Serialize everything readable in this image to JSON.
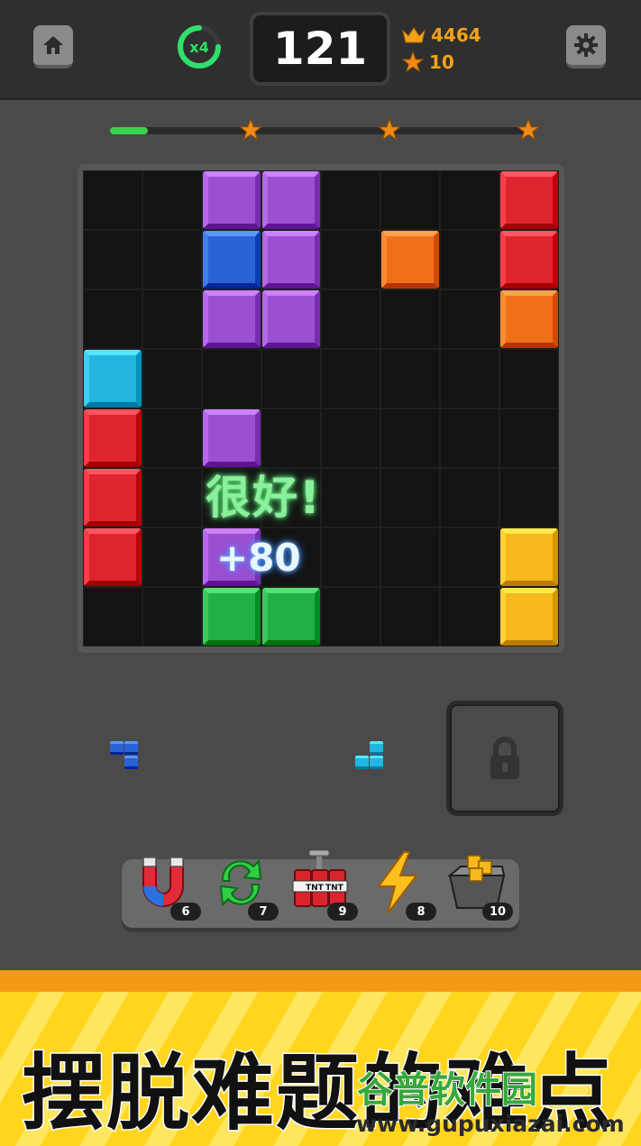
{
  "header": {
    "home_icon": "home-icon",
    "combo_multiplier": "x4",
    "score": "121",
    "best_score": "4464",
    "stars": "10",
    "settings_icon": "gear-icon"
  },
  "progress": {
    "fill_fraction": 0.09,
    "milestone_icon": "star-icon",
    "milestones": 3
  },
  "board": {
    "rows": 8,
    "cols": 8,
    "blocks": [
      {
        "row": 0,
        "col": 2,
        "color": "#9b4fd1"
      },
      {
        "row": 0,
        "col": 3,
        "color": "#9b4fd1"
      },
      {
        "row": 0,
        "col": 7,
        "color": "#e0242f"
      },
      {
        "row": 1,
        "col": 2,
        "color": "#2a63d6"
      },
      {
        "row": 1,
        "col": 3,
        "color": "#9b4fd1"
      },
      {
        "row": 1,
        "col": 5,
        "color": "#f0701a"
      },
      {
        "row": 1,
        "col": 7,
        "color": "#e0242f"
      },
      {
        "row": 2,
        "col": 2,
        "color": "#9b4fd1"
      },
      {
        "row": 2,
        "col": 3,
        "color": "#9b4fd1"
      },
      {
        "row": 2,
        "col": 7,
        "color": "#f0701a"
      },
      {
        "row": 3,
        "col": 0,
        "color": "#22b6e0"
      },
      {
        "row": 4,
        "col": 0,
        "color": "#e0242f"
      },
      {
        "row": 4,
        "col": 2,
        "color": "#9b4fd1"
      },
      {
        "row": 5,
        "col": 0,
        "color": "#e0242f"
      },
      {
        "row": 6,
        "col": 0,
        "color": "#e0242f"
      },
      {
        "row": 6,
        "col": 2,
        "color": "#9b4fd1"
      },
      {
        "row": 6,
        "col": 7,
        "color": "#f6b81c"
      },
      {
        "row": 7,
        "col": 2,
        "color": "#22b046"
      },
      {
        "row": 7,
        "col": 3,
        "color": "#22b046"
      },
      {
        "row": 7,
        "col": 7,
        "color": "#f6b81c"
      }
    ],
    "praise": "很好!",
    "points": "+80"
  },
  "pieces": [
    {
      "name": "piece-blue",
      "color": "#2a63d6",
      "cells": [
        [
          0,
          0
        ],
        [
          0,
          1
        ],
        [
          1,
          1
        ]
      ]
    },
    {
      "name": "piece-cyan",
      "color": "#22b6e0",
      "cells": [
        [
          0,
          1
        ],
        [
          1,
          0
        ],
        [
          1,
          1
        ]
      ]
    }
  ],
  "locked_slot": {
    "icon": "lock-icon"
  },
  "boosters": [
    {
      "name": "magnet",
      "icon": "magnet-icon",
      "count": "6"
    },
    {
      "name": "refresh",
      "icon": "refresh-icon",
      "count": "7"
    },
    {
      "name": "tnt",
      "icon": "tnt-icon",
      "label": "TNT",
      "count": "9"
    },
    {
      "name": "lightning",
      "icon": "lightning-icon",
      "count": "8"
    },
    {
      "name": "cart",
      "icon": "block-cart-icon",
      "count": "10"
    }
  ],
  "banner": {
    "slogan": "摆脱难题的难点",
    "watermark": "谷普软件园",
    "watermark_url": "www.gupuxiazai.com"
  }
}
